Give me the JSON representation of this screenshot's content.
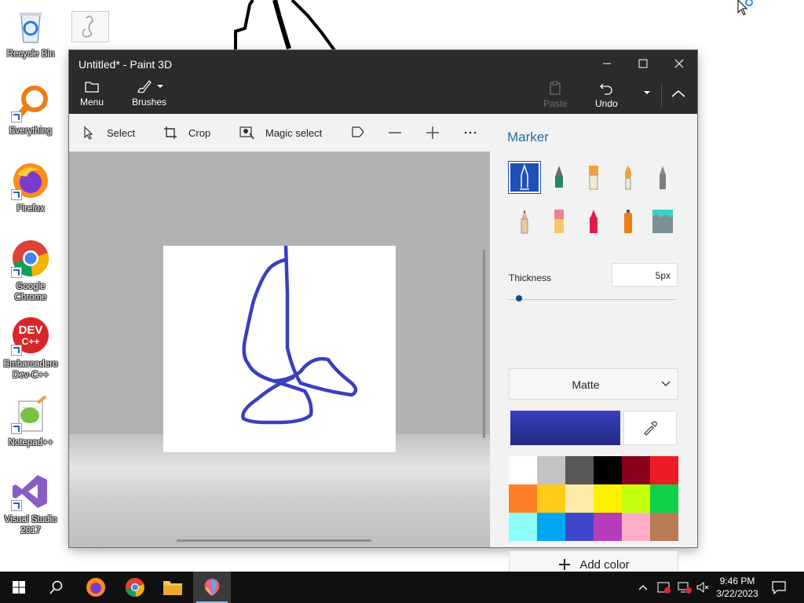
{
  "desktop": {
    "icons": [
      {
        "id": "recycle",
        "label": "Recycle Bin",
        "icon": "recycle-bin-icon"
      },
      {
        "id": "everything",
        "label": "Everything",
        "icon": "search-magnifier-icon"
      },
      {
        "id": "firefox",
        "label": "Firefox",
        "icon": "firefox-icon"
      },
      {
        "id": "chrome",
        "label": "Google Chrome",
        "icon": "chrome-icon"
      },
      {
        "id": "devcpp",
        "label": "Embarcadero Dev-C++",
        "icon": "dev-cpp-icon",
        "badge": "DEV C++"
      },
      {
        "id": "notepadpp",
        "label": "Notepad++",
        "icon": "notepad-plus-plus-icon"
      },
      {
        "id": "vs",
        "label": "Visual Studio 2017",
        "icon": "visual-studio-icon"
      }
    ]
  },
  "window": {
    "title": "Untitled* - Paint 3D",
    "ribbon": {
      "menu": "Menu",
      "brushes": "Brushes",
      "paste": "Paste",
      "undo": "Undo"
    },
    "toolbar": {
      "select": "Select",
      "crop": "Crop",
      "magic_select": "Magic select"
    },
    "panel": {
      "title": "Marker",
      "brushes": [
        {
          "name": "marker",
          "selected": true
        },
        {
          "name": "calligraphy-pen"
        },
        {
          "name": "oil-brush"
        },
        {
          "name": "watercolor"
        },
        {
          "name": "pixel-pen"
        },
        {
          "name": "pencil"
        },
        {
          "name": "eraser"
        },
        {
          "name": "crayon"
        },
        {
          "name": "spray-can"
        },
        {
          "name": "fill"
        }
      ],
      "thickness_label": "Thickness",
      "thickness_value": "5px",
      "thickness_level": 0.05,
      "finish": "Matte",
      "current_color": "#3a3fbf",
      "palette": [
        "#ffffff",
        "#c3c3c3",
        "#585858",
        "#000000",
        "#88001b",
        "#ec1c24",
        "#ff7f27",
        "#ffca18",
        "#fdeca6",
        "#fff200",
        "#c4ff0e",
        "#0ed145",
        "#8cfffb",
        "#00a8f3",
        "#3f48cc",
        "#b83dba",
        "#ffaec8",
        "#b97a56"
      ],
      "add_color": "Add color"
    }
  },
  "taskbar": {
    "apps": [
      "windows-start",
      "search",
      "firefox",
      "chrome",
      "file-explorer",
      "paint-3d"
    ],
    "time": "9:46 PM",
    "date": "3/22/2023"
  }
}
